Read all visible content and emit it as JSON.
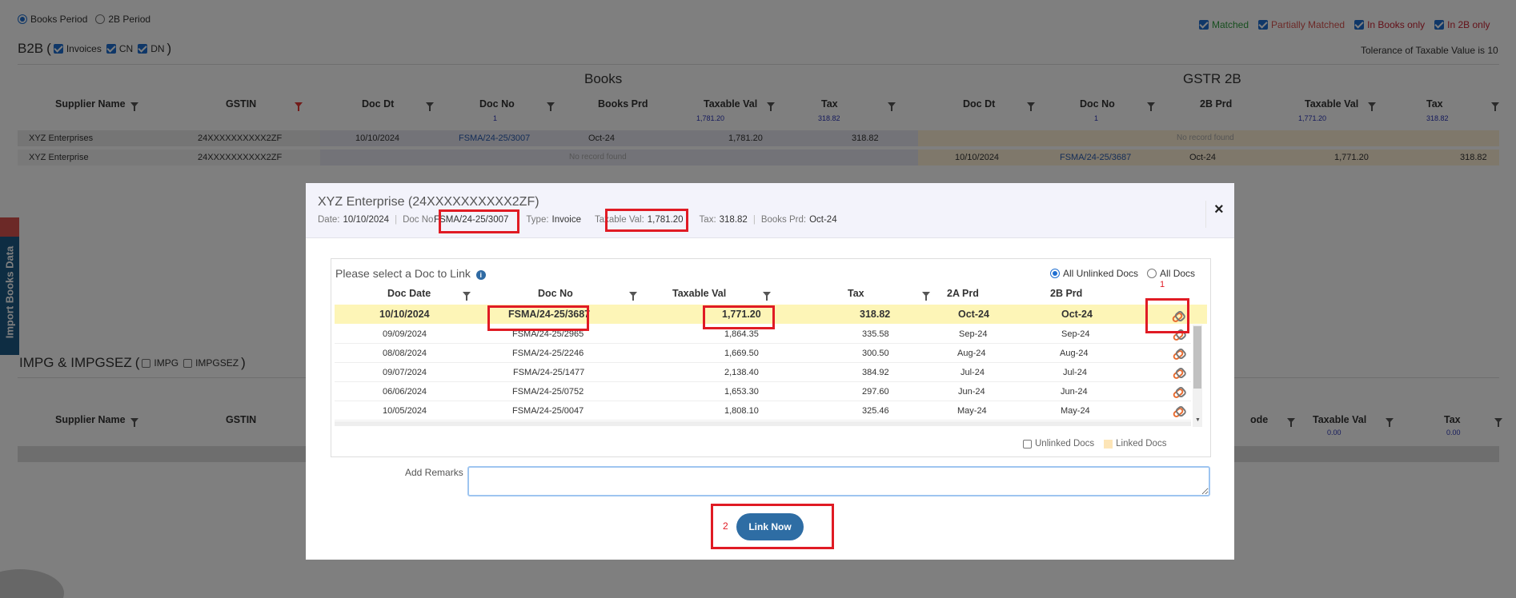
{
  "period": {
    "books": "Books Period",
    "gstr2b": "2B Period"
  },
  "legend": {
    "matched": "Matched",
    "partial": "Partially Matched",
    "books_only": "In Books only",
    "b2_only": "In 2B only",
    "tolerance": "Tolerance of Taxable Value is 10"
  },
  "b2b": {
    "title": "B2B",
    "open": "(",
    "close": ")",
    "invoices": "Invoices",
    "cn": "CN",
    "dn": "DN"
  },
  "books_header": "Books",
  "gstr_header": "GSTR 2B",
  "columns": {
    "supplier": "Supplier Name",
    "gstin": "GSTIN",
    "doc_dt": "Doc Dt",
    "doc_no": "Doc No",
    "books_prd": "Books Prd",
    "taxable": "Taxable Val",
    "tax": "Tax",
    "doc_dt2": "Doc Dt",
    "doc_no2": "Doc No",
    "prd2b": "2B Prd",
    "taxable2": "Taxable Val",
    "tax2": "Tax"
  },
  "totals": {
    "books_docs": "1",
    "books_taxable": "1,781.20",
    "books_tax": "318.82",
    "gstr_docs": "1",
    "gstr_taxable": "1,771.20",
    "gstr_tax": "318.82"
  },
  "rows": [
    {
      "supplier": "XYZ Enterprises",
      "gstin": "24XXXXXXXXXX2ZF",
      "doc_dt": "10/10/2024",
      "doc_no": "FSMA/24-25/3007",
      "books_prd": "Oct-24",
      "taxable": "1,781.20",
      "tax": "318.82",
      "gstr_empty": "No record found"
    },
    {
      "supplier": "XYZ Enterprise",
      "gstin": "24XXXXXXXXXX2ZF",
      "books_empty": "No record found",
      "doc_dt2": "10/10/2024",
      "doc_no2": "FSMA/24-25/3687",
      "prd2b": "Oct-24",
      "taxable2": "1,771.20",
      "tax2": "318.82"
    }
  ],
  "side_tab": "Import Books Data",
  "impg": {
    "title": "IMPG & IMPGSEZ",
    "open": "(",
    "close": ")",
    "impg": "IMPG",
    "impgsez": "IMPGSEZ",
    "supplier": "Supplier Name",
    "gstin": "GSTIN",
    "code": "ode",
    "taxable": "Taxable Val",
    "tax": "Tax",
    "taxable_total": "0.00",
    "tax_total": "0.00"
  },
  "modal": {
    "title": "XYZ Enterprise (24XXXXXXXXXX2ZF)",
    "date_label": "Date:",
    "date": "10/10/2024",
    "docno_label": "Doc No:",
    "docno": "FSMA/24-25/3007",
    "type_label": "Type:",
    "type": "Invoice",
    "taxable_label": "Taxable Val:",
    "taxable": "1,781.20",
    "tax_label": "Tax:",
    "tax": "318.82",
    "prd_label": "Books Prd:",
    "prd": "Oct-24",
    "close": "×",
    "select_label": "Please select a Doc to Link",
    "opt_unlinked": "All Unlinked Docs",
    "opt_all": "All Docs",
    "cols": {
      "doc_date": "Doc Date",
      "doc_no": "Doc No",
      "taxable": "Taxable Val",
      "tax": "Tax",
      "prd2a": "2A Prd",
      "prd2b": "2B Prd"
    },
    "docs": [
      {
        "date": "10/10/2024",
        "no": "FSMA/24-25/3687",
        "taxable": "1,771.20",
        "tax": "318.82",
        "a": "Oct-24",
        "b": "Oct-24"
      },
      {
        "date": "09/09/2024",
        "no": "FSMA/24-25/2965",
        "taxable": "1,864.35",
        "tax": "335.58",
        "a": "Sep-24",
        "b": "Sep-24"
      },
      {
        "date": "08/08/2024",
        "no": "FSMA/24-25/2246",
        "taxable": "1,669.50",
        "tax": "300.50",
        "a": "Aug-24",
        "b": "Aug-24"
      },
      {
        "date": "09/07/2024",
        "no": "FSMA/24-25/1477",
        "taxable": "2,138.40",
        "tax": "384.92",
        "a": "Jul-24",
        "b": "Jul-24"
      },
      {
        "date": "06/06/2024",
        "no": "FSMA/24-25/0752",
        "taxable": "1,653.30",
        "tax": "297.60",
        "a": "Jun-24",
        "b": "Jun-24"
      },
      {
        "date": "10/05/2024",
        "no": "FSMA/24-25/0047",
        "taxable": "1,808.10",
        "tax": "325.46",
        "a": "May-24",
        "b": "May-24"
      }
    ],
    "unlinked_docs": "Unlinked Docs",
    "linked_docs": "Linked Docs",
    "remarks_label": "Add Remarks",
    "remarks_value": "",
    "step1": "1",
    "step2": "2",
    "link_now": "Link Now"
  }
}
